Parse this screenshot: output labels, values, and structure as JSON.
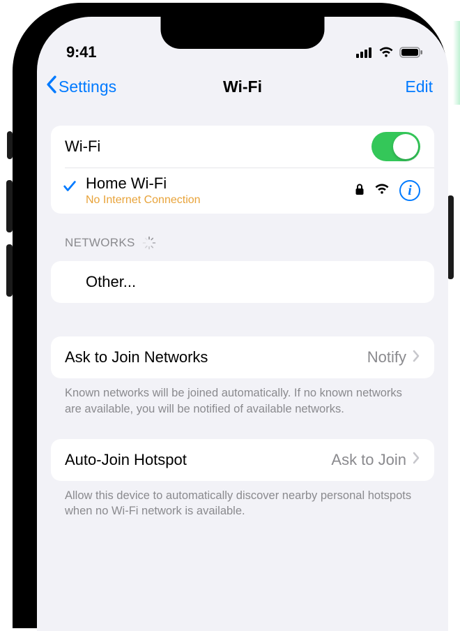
{
  "status": {
    "time": "9:41"
  },
  "nav": {
    "back": "Settings",
    "title": "Wi-Fi",
    "edit": "Edit"
  },
  "wifi": {
    "toggle_label": "Wi-Fi",
    "connected": {
      "name": "Home Wi-Fi",
      "subtitle": "No Internet Connection"
    }
  },
  "networks": {
    "header": "NETWORKS",
    "other": "Other..."
  },
  "ask": {
    "label": "Ask to Join Networks",
    "value": "Notify",
    "footer": "Known networks will be joined automatically. If no known networks are available, you will be notified of available networks."
  },
  "hotspot": {
    "label": "Auto-Join Hotspot",
    "value": "Ask to Join",
    "footer": "Allow this device to automatically discover nearby personal hotspots when no Wi-Fi network is available."
  }
}
